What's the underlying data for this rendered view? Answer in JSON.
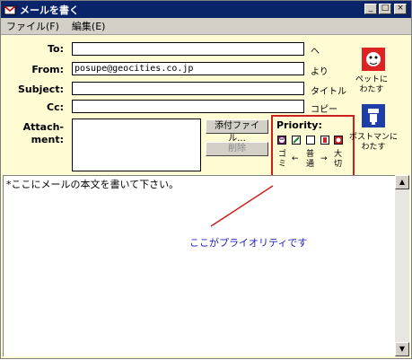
{
  "window": {
    "title": "メールを書く"
  },
  "titlebar_buttons": {
    "minimize": "_",
    "maximize": "□",
    "close": "×"
  },
  "menu": {
    "file": "ファイル(F)",
    "edit": "編集(E)"
  },
  "fields": [
    {
      "label": "To:",
      "value": "",
      "suffix": "へ"
    },
    {
      "label": "From:",
      "value": "posupe@geocities.co.jp",
      "suffix": "より"
    },
    {
      "label": "Subject:",
      "value": "",
      "suffix": "タイトル"
    },
    {
      "label": "Cc:",
      "value": "",
      "suffix": "コピー"
    }
  ],
  "attach": {
    "label_line1": "Attach-",
    "label_line2": "ment:"
  },
  "buttons": {
    "attach_file": "添付ファイル...",
    "delete": "削除"
  },
  "priority": {
    "title": "Priority:",
    "labels": [
      "ゴ",
      "ミ",
      "←",
      "普",
      "通",
      "→",
      "大",
      "切"
    ],
    "colors": {
      "trash": "#cc2222",
      "normal": "#eeeeee",
      "important": "#cc2222"
    }
  },
  "side": {
    "pet_label_line1": "ペットに",
    "pet_label_line2": "わたす",
    "postman_label_line1": "ポストマンに",
    "postman_label_line2": "わたす",
    "pet_icon": "pet-icon",
    "postman_icon": "postman-icon"
  },
  "body": {
    "text": "*ここにメールの本文を書いて下さい。"
  },
  "annotation": {
    "text": "ここがプライオリティです"
  },
  "scroll": {
    "up": "▲",
    "down": "▼"
  }
}
